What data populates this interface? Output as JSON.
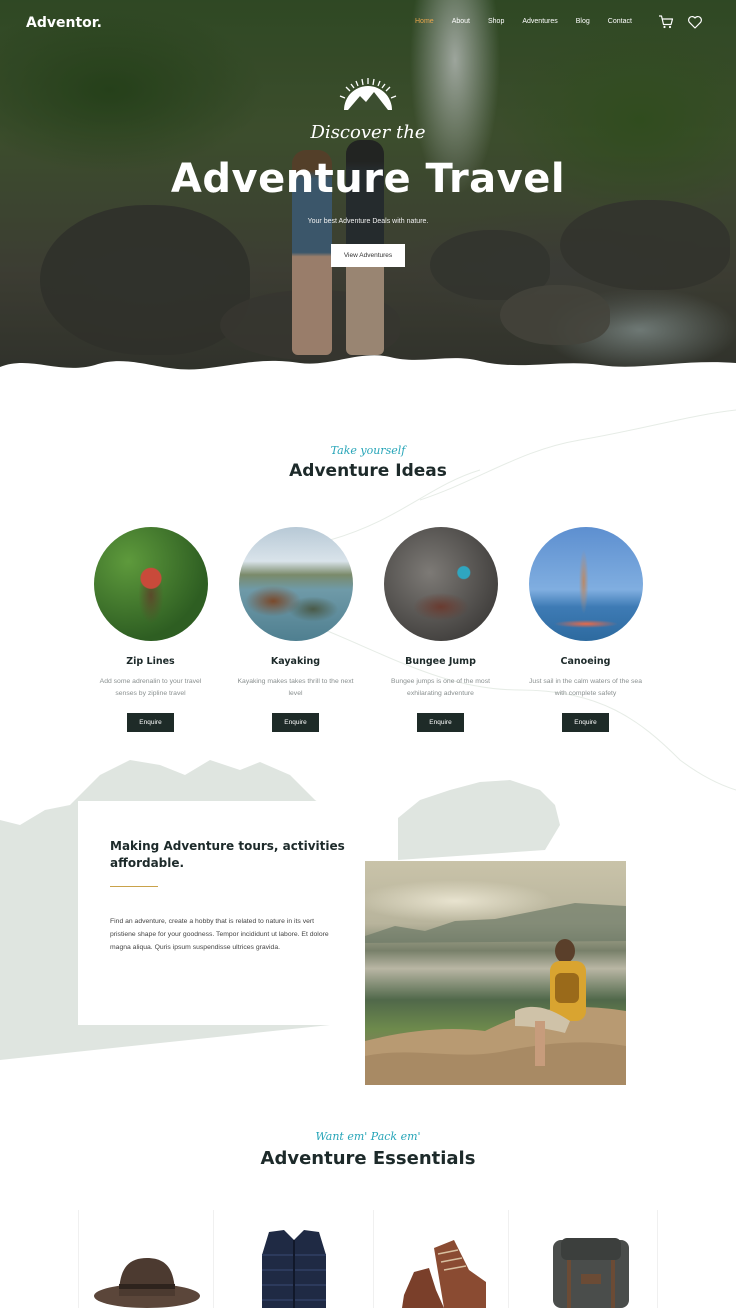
{
  "nav": {
    "logo": "Adventor.",
    "items": [
      "Home",
      "About",
      "Shop",
      "Adventures",
      "Blog",
      "Contact"
    ],
    "active_index": 0,
    "icons": [
      "cart-icon",
      "heart-icon"
    ]
  },
  "hero": {
    "script": "Discover the",
    "title": "Adventure Travel",
    "subtitle": "Your best Adventure Deals with nature.",
    "button": "View Adventures"
  },
  "ideas": {
    "eyebrow": "Take yourself",
    "title": "Adventure Ideas",
    "items": [
      {
        "title": "Zip Lines",
        "desc": "Add some adrenalin to your travel senses by zipline travel",
        "button": "Enquire"
      },
      {
        "title": "Kayaking",
        "desc": "Kayaking makes takes thrill to the next level",
        "button": "Enquire"
      },
      {
        "title": "Bungee Jump",
        "desc": "Bungee jumps is one of the most exhilarating adventure",
        "button": "Enquire"
      },
      {
        "title": "Canoeing",
        "desc": "Just sail in the calm waters of the sea with complete safety",
        "button": "Enquire"
      }
    ]
  },
  "affordable": {
    "title": "Making Adventure tours, activities affordable.",
    "body": "Find an adventure, create a hobby that is related to nature in its vert pristiene shape for your goodness. Tempor incididunt ut labore. Et dolore magna aliqua. Quris ipsum suspendisse ultrices gravida."
  },
  "essentials": {
    "eyebrow": "Want em' Pack em'",
    "title": "Adventure Essentials",
    "products": [
      "hat",
      "vest",
      "boots",
      "backpack"
    ]
  },
  "colors": {
    "accent_teal": "#27a5b8",
    "nav_active": "#e9a64c",
    "button_dark": "#1e2b28",
    "rule_gold": "#c9a24a",
    "mountain_grey": "#dfe5e0"
  }
}
